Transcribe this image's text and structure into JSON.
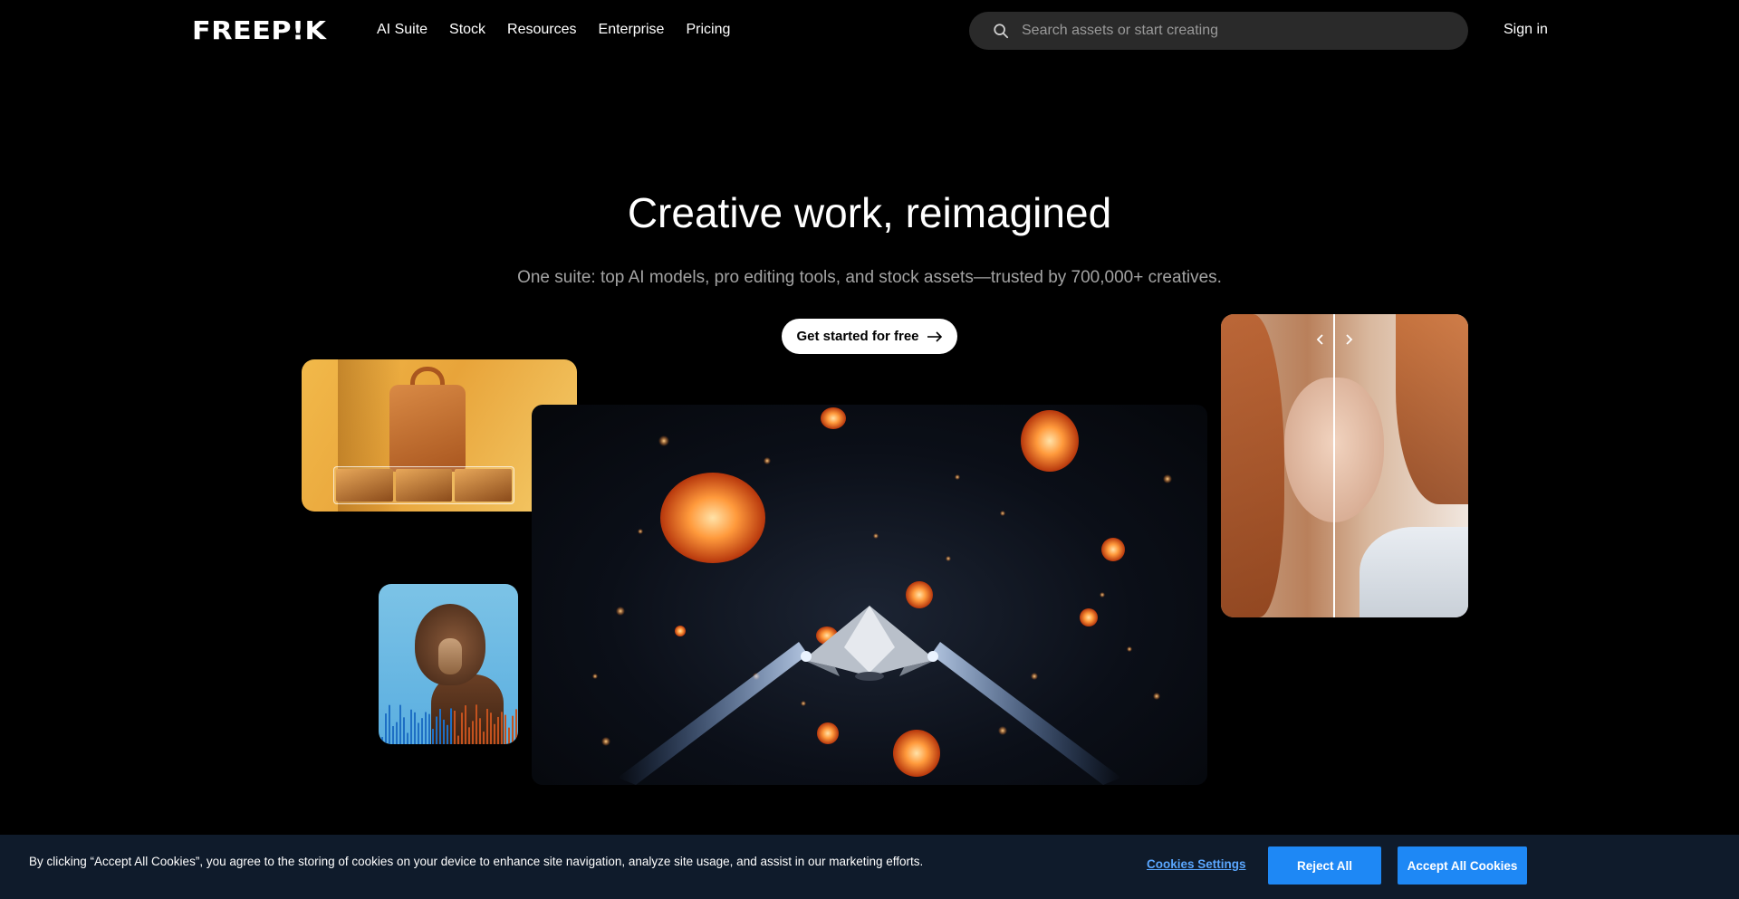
{
  "header": {
    "logo_text": "FREEP!K",
    "nav": [
      {
        "label": "AI Suite"
      },
      {
        "label": "Stock"
      },
      {
        "label": "Resources"
      },
      {
        "label": "Enterprise"
      },
      {
        "label": "Pricing"
      }
    ],
    "search": {
      "placeholder": "Search assets or start creating",
      "icon": "search-icon"
    },
    "signin_label": "Sign in"
  },
  "hero": {
    "title": "Creative work, reimagined",
    "subtitle": "One suite: top AI models, pro editing tools, and stock assets—trusted by 700,000+ creatives.",
    "cta_label": "Get started for free",
    "cta_icon": "arrow-right-icon"
  },
  "showcase": {
    "cards": [
      {
        "name": "bag-product-card"
      },
      {
        "name": "spaceship-video-card"
      },
      {
        "name": "portrait-compare-card",
        "icons": [
          "chevron-left-icon",
          "chevron-right-icon"
        ]
      },
      {
        "name": "music-audio-card"
      }
    ]
  },
  "cookies": {
    "text": "By clicking “Accept All Cookies”, you agree to the storing of cookies on your device to enhance site navigation, analyze site usage, and assist in our marketing efforts.",
    "settings_label": "Cookies Settings",
    "reject_label": "Reject All",
    "accept_label": "Accept All Cookies"
  },
  "colors": {
    "background": "#000000",
    "search_bg": "#2a2a2a",
    "cookie_bar": "#0f1b2b",
    "cookie_button": "#1e88f5",
    "cookie_link": "#5aa7ff"
  }
}
